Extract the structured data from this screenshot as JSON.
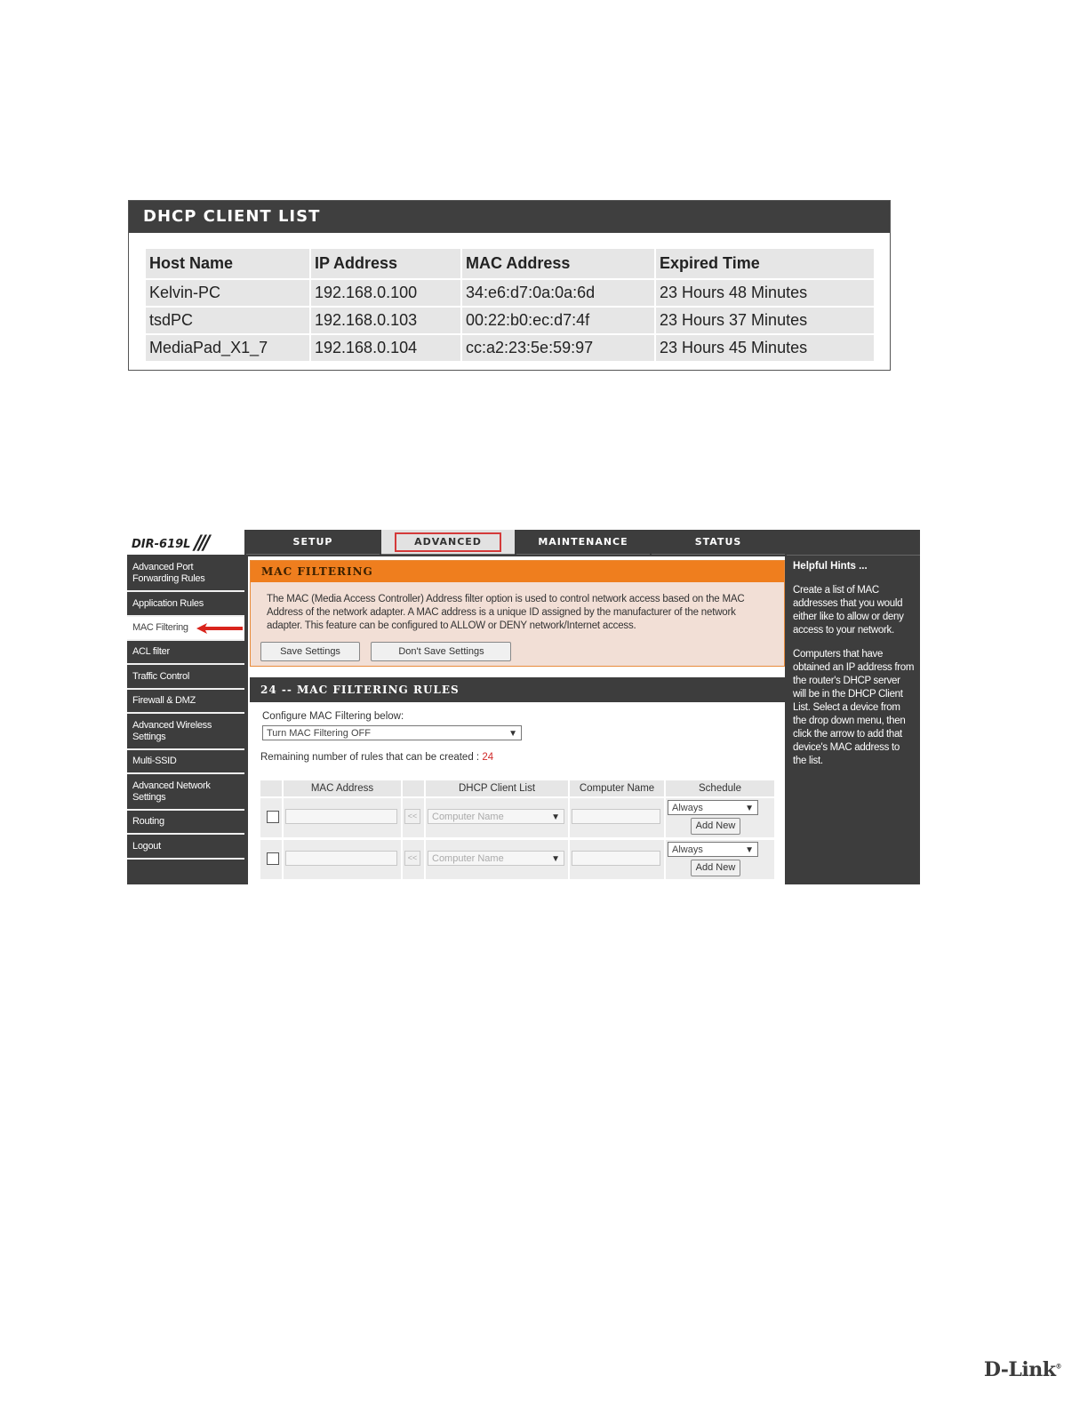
{
  "dhcp": {
    "title": "DHCP CLIENT LIST",
    "columns": [
      "Host Name",
      "IP Address",
      "MAC Address",
      "Expired Time"
    ],
    "rows": [
      [
        "Kelvin-PC",
        "192.168.0.100",
        "34:e6:d7:0a:0a:6d",
        "23 Hours 48 Minutes"
      ],
      [
        "tsdPC",
        "192.168.0.103",
        "00:22:b0:ec:d7:4f",
        "23 Hours 37 Minutes"
      ],
      [
        "MediaPad_X1_7",
        "192.168.0.104",
        "cc:a2:23:5e:59:97",
        "23 Hours 45 Minutes"
      ]
    ]
  },
  "router": {
    "model": "DIR-619L",
    "tabs": [
      "SETUP",
      "ADVANCED",
      "MAINTENANCE",
      "STATUS"
    ],
    "active_tab": "ADVANCED",
    "sidebar": [
      "Advanced Port Forwarding Rules",
      "Application Rules",
      "MAC Filtering",
      "ACL filter",
      "Traffic Control",
      "Firewall & DMZ",
      "Advanced Wireless Settings",
      "Multi-SSID",
      "Advanced Network Settings",
      "Routing",
      "Logout"
    ],
    "active_sidebar": "MAC Filtering",
    "mac_filtering": {
      "title": "MAC FILTERING",
      "description": "The MAC (Media Access Controller) Address filter option is used to control network access based on the MAC Address of the network adapter. A MAC address is a unique ID assigned by the manufacturer of the network adapter. This feature can be configured to ALLOW or DENY network/Internet access.",
      "save_label": "Save Settings",
      "dont_save_label": "Don't Save Settings"
    },
    "rules": {
      "title": "24 -- MAC FILTERING RULES",
      "configure_label": "Configure MAC Filtering below:",
      "mode_value": "Turn MAC Filtering OFF",
      "remaining_label": "Remaining number of rules that can be created :",
      "remaining_count": "24",
      "columns": [
        "MAC Address",
        "DHCP Client List",
        "Computer Name",
        "Schedule"
      ],
      "copy_label": "<<",
      "client_placeholder": "Computer Name",
      "schedule_value": "Always",
      "add_new_label": "Add New"
    },
    "hints": {
      "title": "Helpful Hints ...",
      "p1": "Create a list of MAC addresses that you would either like to allow or deny access to your network.",
      "p2": "Computers that have obtained an IP address from the router's DHCP server will be in the DHCP Client List. Select a device from the drop down menu, then click the arrow to add that device's MAC address to the list."
    }
  },
  "footer": {
    "logo": "D-Link"
  },
  "colors": {
    "accent": "#ef7e1e",
    "dark": "#3d3d3d",
    "highlight": "#d43a3a"
  }
}
